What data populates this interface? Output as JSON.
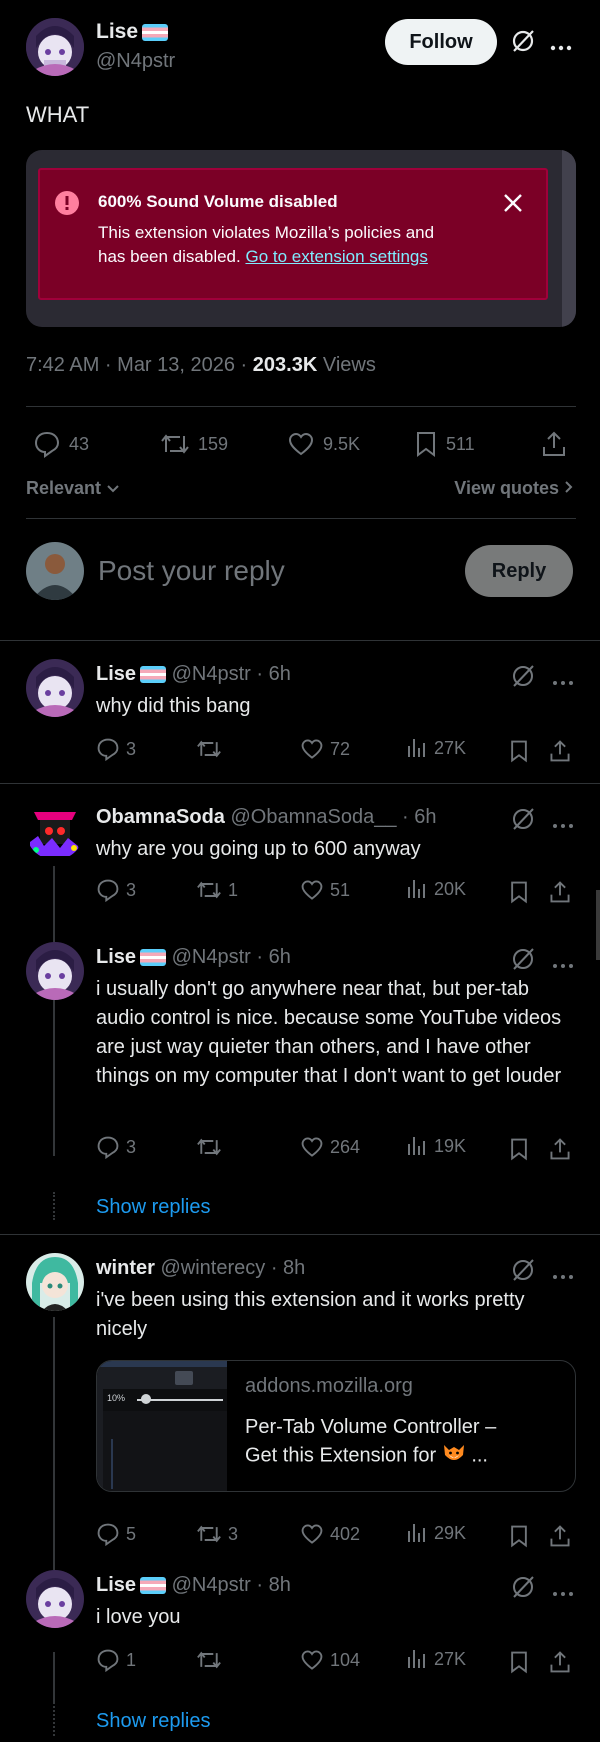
{
  "post": {
    "author_name": "Lise",
    "author_handle": "@N4pstr",
    "follow_label": "Follow",
    "text": "WHAT",
    "alert": {
      "title": "600% Sound Volume disabled",
      "body_line1": "This extension violates Mozilla’s policies and",
      "body_line2": "has been disabled.",
      "link": "Go to extension settings"
    },
    "time": "7:42 AM · Mar 13, 2026 · ",
    "views_count": "203.3K",
    "views_label": " Views",
    "stats": {
      "replies": "43",
      "reposts": "159",
      "likes": "9.5K",
      "bookmarks": "511"
    },
    "sort_label": "Relevant",
    "view_quotes_label": "View quotes"
  },
  "composer": {
    "placeholder": "Post your reply",
    "reply_label": "Reply"
  },
  "replies": [
    {
      "name": "Lise",
      "handle": "@N4pstr",
      "time": "· 6h",
      "text": "why did this bang",
      "replies": "3",
      "reposts": "",
      "likes": "72",
      "views": "27K"
    },
    {
      "name": "ObamnaSoda",
      "handle": "@ObamnaSoda__",
      "time": "· 6h",
      "text": "why are you going up to 600 anyway",
      "replies": "3",
      "reposts": "1",
      "likes": "51",
      "views": "20K"
    },
    {
      "name": "Lise",
      "handle": "@N4pstr",
      "time": "· 6h",
      "text": "i usually don't go anywhere near that, but per-tab audio control is nice. because some YouTube videos are just way quieter than others, and I have other things on my computer that I don't want to get louder",
      "replies": "3",
      "reposts": "",
      "likes": "264",
      "views": "19K"
    },
    {
      "name": "winter",
      "handle": "@winterecy",
      "time": "· 8h",
      "text": "i've been using this extension and it works pretty nicely",
      "replies": "5",
      "reposts": "3",
      "likes": "402",
      "views": "29K"
    },
    {
      "name": "Lise",
      "handle": "@N4pstr",
      "time": "· 8h",
      "text": "i love you",
      "replies": "1",
      "reposts": "",
      "likes": "104",
      "views": "27K"
    }
  ],
  "link_card": {
    "domain": "addons.mozilla.org",
    "title_line1": "Per-Tab Volume Controller –",
    "title_line2": "Get this Extension for",
    "title_suffix": " ...",
    "thumb_volume": "10%"
  },
  "show_replies_label": "Show replies"
}
